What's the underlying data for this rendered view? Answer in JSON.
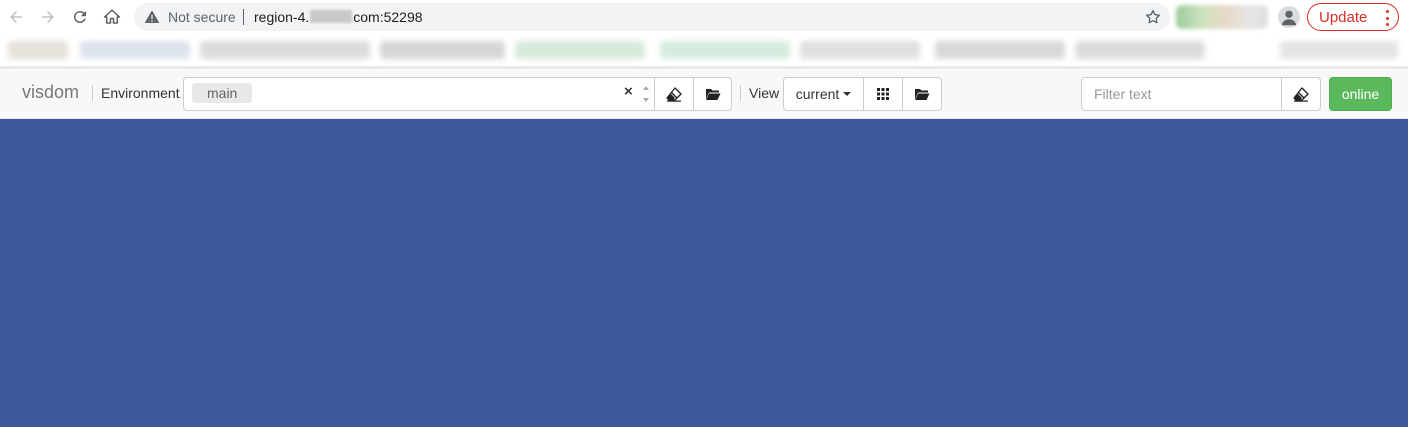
{
  "browser": {
    "not_secure_label": "Not secure",
    "url_prefix": "region-4.",
    "url_suffix": "com:52298",
    "update_label": "Update"
  },
  "toolbar": {
    "brand": "visdom",
    "environment_label": "Environment",
    "environment_chip": "main",
    "clear_symbol": "×",
    "view_label": "View",
    "view_selected": "current",
    "filter_placeholder": "Filter text",
    "status_label": "online"
  },
  "colors": {
    "workspace_bg": "#3b5998",
    "online_green": "#5cb85c",
    "update_red": "#d93025"
  }
}
